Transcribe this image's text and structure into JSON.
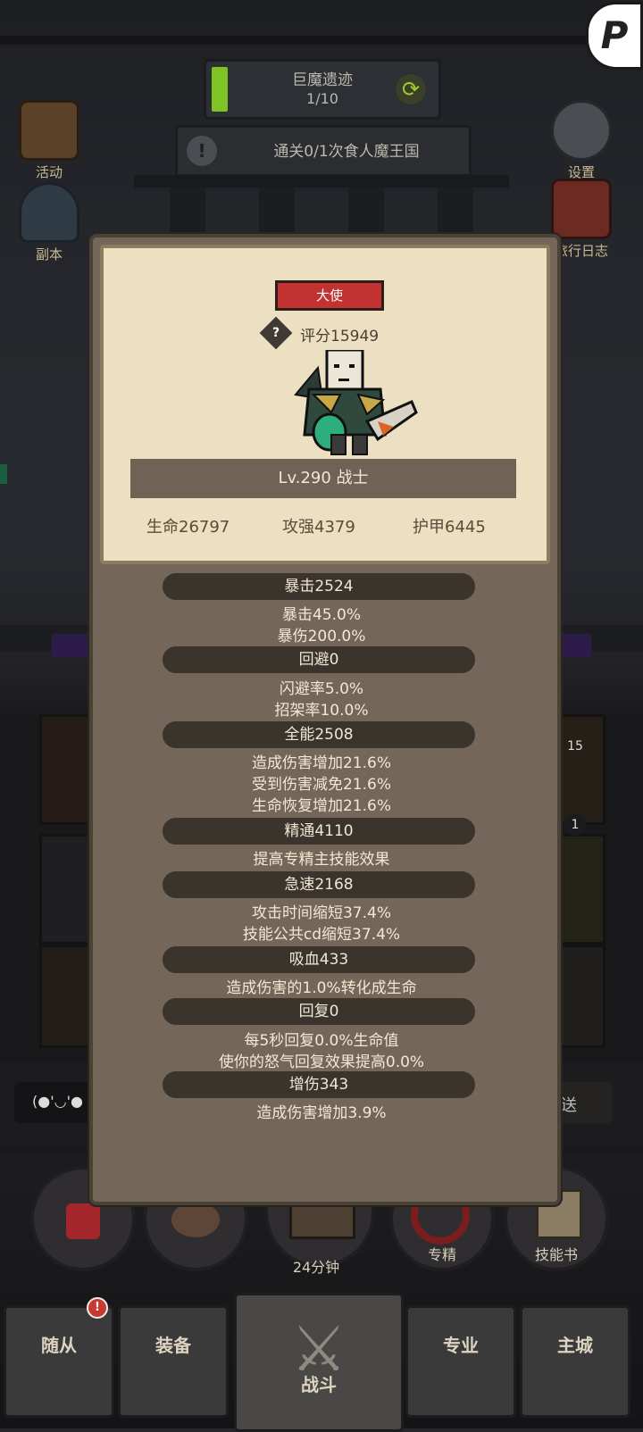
{
  "top_left": {
    "activity_label": "活动",
    "dungeon_label": "副本"
  },
  "top_right": {
    "settings_label": "设置",
    "journal_label": "旅行日志"
  },
  "quest": {
    "title": "巨魔遗迹",
    "progress_text": "1/10",
    "subtitle": "通关0/1次食人魔王国"
  },
  "hero_card": {
    "rank_badge": "大使",
    "score": "评分15949",
    "level_class": "Lv.290 战士",
    "hp": "生命26797",
    "attack": "攻强4379",
    "armor": "护甲6445"
  },
  "stats": [
    {
      "title": "暴击2524",
      "lines": [
        "暴击45.0%",
        "暴伤200.0%"
      ]
    },
    {
      "title": "回避0",
      "lines": [
        "闪避率5.0%",
        "招架率10.0%"
      ]
    },
    {
      "title": "全能2508",
      "lines": [
        "造成伤害增加21.6%",
        "受到伤害减免21.6%",
        "生命恢复增加21.6%"
      ]
    },
    {
      "title": "精通4110",
      "lines": [
        "提高专精主技能效果"
      ]
    },
    {
      "title": "急速2168",
      "lines": [
        "攻击时间缩短37.4%",
        "技能公共cd缩短37.4%"
      ]
    },
    {
      "title": "吸血433",
      "lines": [
        "造成伤害的1.0%转化成生命"
      ]
    },
    {
      "title": "回复0",
      "lines": [
        "每5秒回复0.0%生命值",
        "使你的怒气回复效果提高0.0%"
      ]
    },
    {
      "title": "增伤343",
      "lines": [
        "造成伤害增加3.9%"
      ]
    }
  ],
  "side_badges": {
    "count_top": "15",
    "count_bottom": "1"
  },
  "chat": {
    "emoticon": "(●'◡'●",
    "send_label": "发送"
  },
  "hud": {
    "chest_timer": "24分钟",
    "specialization_label": "专精",
    "skillbook_label": "技能书"
  },
  "tabs": [
    "随从",
    "装备",
    "战斗",
    "专业",
    "主城"
  ],
  "logo_letter": "P"
}
